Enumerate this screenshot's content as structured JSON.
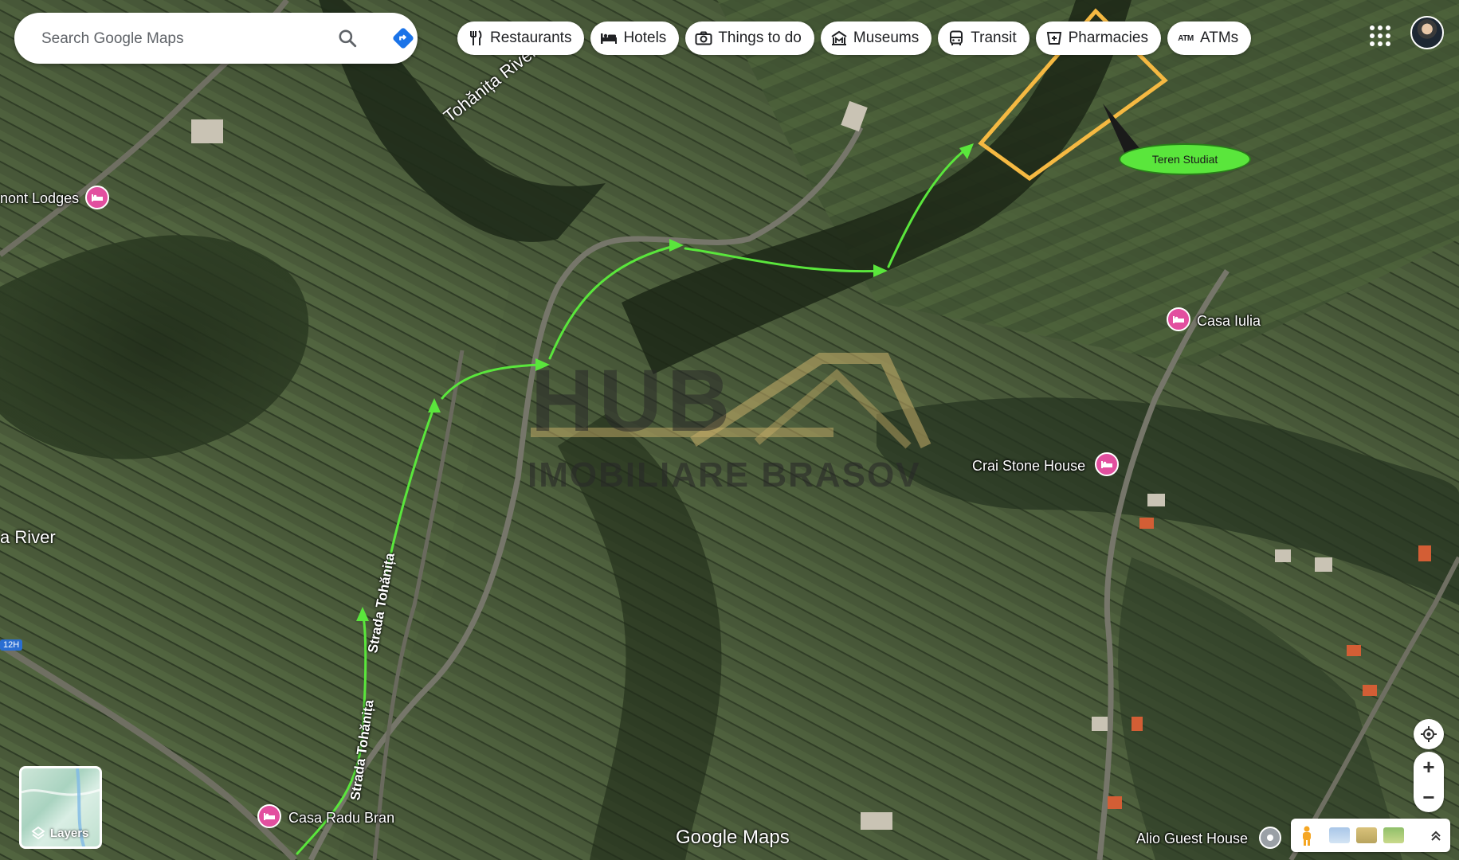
{
  "search": {
    "placeholder": "Search Google Maps"
  },
  "chips": [
    {
      "icon": "fork-knife-icon",
      "label": "Restaurants"
    },
    {
      "icon": "bed-icon",
      "label": "Hotels"
    },
    {
      "icon": "camera-icon",
      "label": "Things to do"
    },
    {
      "icon": "museum-icon",
      "label": "Museums"
    },
    {
      "icon": "bus-icon",
      "label": "Transit"
    },
    {
      "icon": "pharmacy-icon",
      "label": "Pharmacies"
    },
    {
      "icon": "atm-icon",
      "label": "ATMs",
      "icon_text": "ATM"
    }
  ],
  "places": {
    "lodges": "nont Lodges",
    "casa_iulia": "Casa Iulia",
    "crai_stone": "Crai Stone House",
    "casa_radu": "Casa Radu Bran",
    "alio": "Alio Guest House"
  },
  "roads": {
    "tohanita_1": "Strada Tohănița",
    "tohanita_2": "Strada Tohănița",
    "route_badge": "12H"
  },
  "rivers": {
    "tohanita_river": "Tohănița River",
    "river_left": "a River"
  },
  "annotation": {
    "callout": "Teren Studiat",
    "route_color": "#5ae63c",
    "plot_color": "#f5b942"
  },
  "watermark": {
    "line1": "HUB",
    "line2": "IMOBILIARE BRASOV"
  },
  "layers": {
    "label": "Layers"
  },
  "branding": {
    "logo": "Google Maps"
  },
  "controls": {
    "zoom_in": "+",
    "zoom_out": "−"
  },
  "colors": {
    "pin": "#e24f9f"
  }
}
